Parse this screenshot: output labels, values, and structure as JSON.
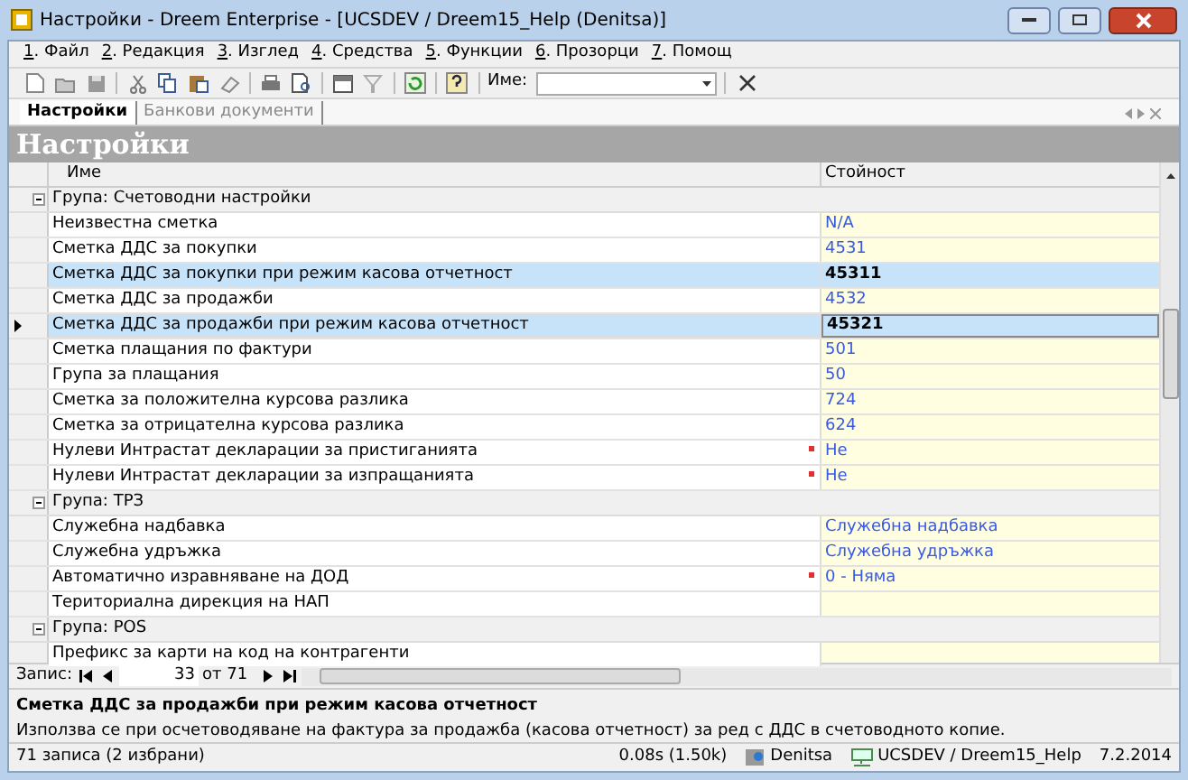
{
  "window": {
    "title": "Настройки - Dreem Enterprise - [UCSDEV / Dreem15_Help (Denitsa)]"
  },
  "menu": [
    "1. Файл",
    "2. Редакция",
    "3. Изглед",
    "4. Средства",
    "5. Функции",
    "6. Прозорци",
    "7. Помощ"
  ],
  "toolbar": {
    "name_label": "Име:"
  },
  "tabs": [
    {
      "label": "Настройки",
      "selected": true
    },
    {
      "label": "Банкови документи",
      "selected": false
    }
  ],
  "header": "Настройки",
  "table": {
    "columns": [
      "Име",
      "Стойност"
    ],
    "rows": [
      {
        "kind": "group",
        "name": "Група: Счетоводни настройки",
        "expanded": true
      },
      {
        "kind": "row",
        "name": "Неизвестна сметка",
        "value": "N/A",
        "required": false,
        "selected": false,
        "current": false
      },
      {
        "kind": "row",
        "name": "Сметка ДДС за покупки",
        "value": "4531",
        "required": false,
        "selected": false,
        "current": false
      },
      {
        "kind": "row",
        "name": "Сметка ДДС за покупки при режим касова отчетност",
        "value": "45311",
        "required": false,
        "selected": true,
        "current": false
      },
      {
        "kind": "row",
        "name": "Сметка ДДС за продажби",
        "value": "4532",
        "required": false,
        "selected": false,
        "current": false
      },
      {
        "kind": "row",
        "name": "Сметка ДДС за продажби при режим касова отчетност",
        "value": "45321",
        "required": false,
        "selected": true,
        "current": true
      },
      {
        "kind": "row",
        "name": "Сметка плащания по фактури",
        "value": "501",
        "required": false,
        "selected": false,
        "current": false
      },
      {
        "kind": "row",
        "name": "Група за плащания",
        "value": "50",
        "required": false,
        "selected": false,
        "current": false
      },
      {
        "kind": "row",
        "name": "Сметка за положителна курсова разлика",
        "value": "724",
        "required": false,
        "selected": false,
        "current": false
      },
      {
        "kind": "row",
        "name": "Сметка за отрицателна курсова разлика",
        "value": "624",
        "required": false,
        "selected": false,
        "current": false
      },
      {
        "kind": "row",
        "name": "Нулеви Интрастат декларации за пристиганията",
        "value": "Не",
        "required": true,
        "selected": false,
        "current": false
      },
      {
        "kind": "row",
        "name": "Нулеви Интрастат декларации за изпращанията",
        "value": "Не",
        "required": true,
        "selected": false,
        "current": false
      },
      {
        "kind": "group",
        "name": "Група: ТРЗ",
        "expanded": true
      },
      {
        "kind": "row",
        "name": "Служебна надбавка",
        "value": "Служебна надбавка",
        "required": false,
        "selected": false,
        "current": false
      },
      {
        "kind": "row",
        "name": "Служебна удръжка",
        "value": "Служебна удръжка",
        "required": false,
        "selected": false,
        "current": false
      },
      {
        "kind": "row",
        "name": "Автоматично изравняване на ДОД",
        "value": "0 - Няма",
        "required": true,
        "selected": false,
        "current": false
      },
      {
        "kind": "row",
        "name": "Териториална дирекция на НАП",
        "required": false,
        "selected": false,
        "current": false
      },
      {
        "kind": "group",
        "name": "Група: POS",
        "expanded": true
      },
      {
        "kind": "row",
        "name": "Префикс за карти на код на контрагенти",
        "required": false,
        "selected": false,
        "current": false
      }
    ]
  },
  "navigator": {
    "label": "Запис:",
    "record": "33",
    "total": "от 71"
  },
  "description": {
    "title": "Сметка ДДС за продажби при режим касова отчетност",
    "text": "Използва се при осчетоводяване на фактура за продажба (касова отчетност) за ред с ДДС в счетоводното копие."
  },
  "status_bar": {
    "records": "71 записа (2 избрани)",
    "timing": "0.08s (1.50k)",
    "user": "Denitsa",
    "database": "UCSDEV / Dreem15_Help",
    "date": "7.2.2014"
  }
}
